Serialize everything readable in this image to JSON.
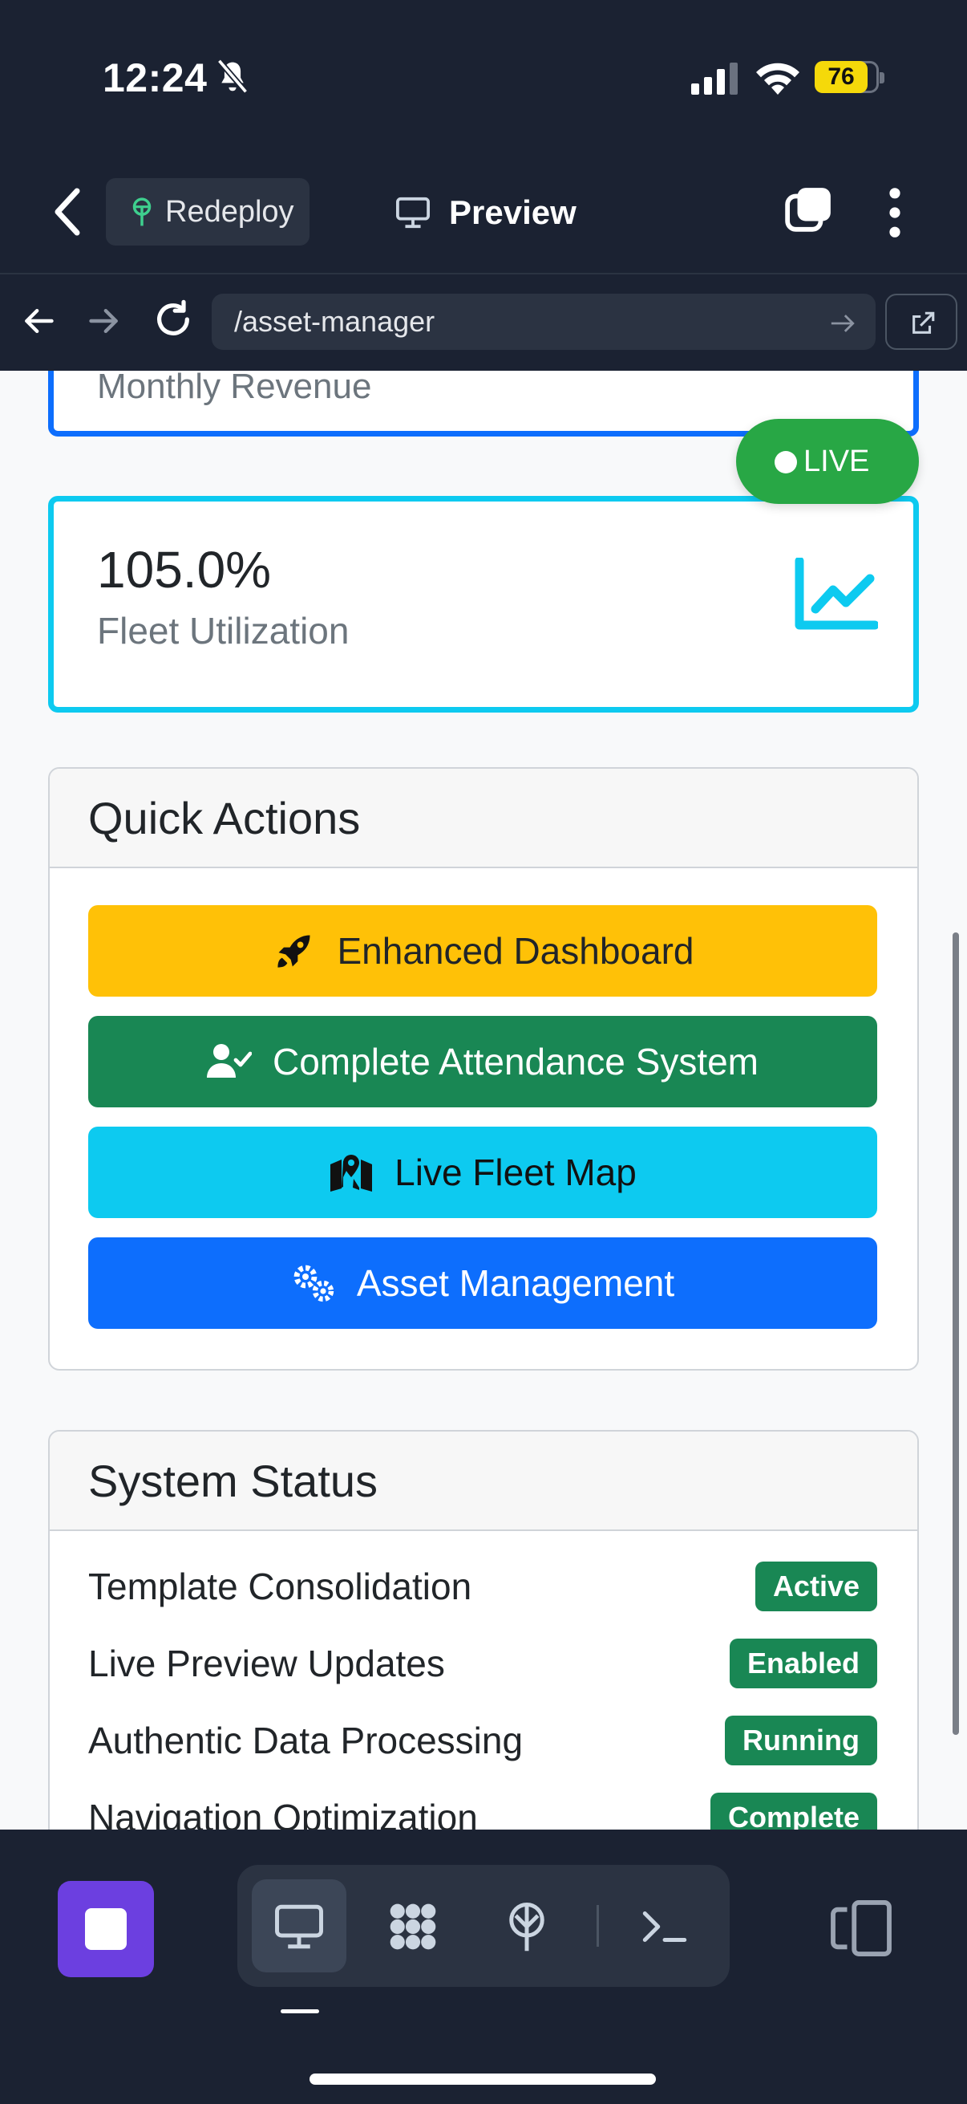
{
  "status_bar": {
    "time": "12:24",
    "battery": "76"
  },
  "header": {
    "redeploy_label": "Redeploy",
    "preview_label": "Preview"
  },
  "browser": {
    "url": "/asset-manager"
  },
  "cards": {
    "previous_label": "Monthly Revenue",
    "live_badge": "LIVE",
    "utilization_value": "105.0%",
    "utilization_label": "Fleet Utilization"
  },
  "quick_actions": {
    "title": "Quick Actions",
    "buttons": [
      {
        "label": "Enhanced Dashboard",
        "icon": "rocket-icon",
        "color": "#ffc107"
      },
      {
        "label": "Complete Attendance System",
        "icon": "user-check-icon",
        "color": "#198754"
      },
      {
        "label": "Live Fleet Map",
        "icon": "map-marker-icon",
        "color": "#0dcaf0"
      },
      {
        "label": "Asset Management",
        "icon": "cogs-icon",
        "color": "#0d6efd"
      }
    ]
  },
  "system_status": {
    "title": "System Status",
    "items": [
      {
        "label": "Template Consolidation",
        "status": "Active"
      },
      {
        "label": "Live Preview Updates",
        "status": "Enabled"
      },
      {
        "label": "Authentic Data Processing",
        "status": "Running"
      },
      {
        "label": "Navigation Optimization",
        "status": "Complete"
      }
    ]
  },
  "colors": {
    "dark_chrome": "#1b2232",
    "primary": "#0d6efd",
    "info": "#0dcaf0",
    "success": "#198754",
    "warning": "#ffc107",
    "live_green": "#28a745",
    "stop_purple": "#6c3fe0"
  }
}
